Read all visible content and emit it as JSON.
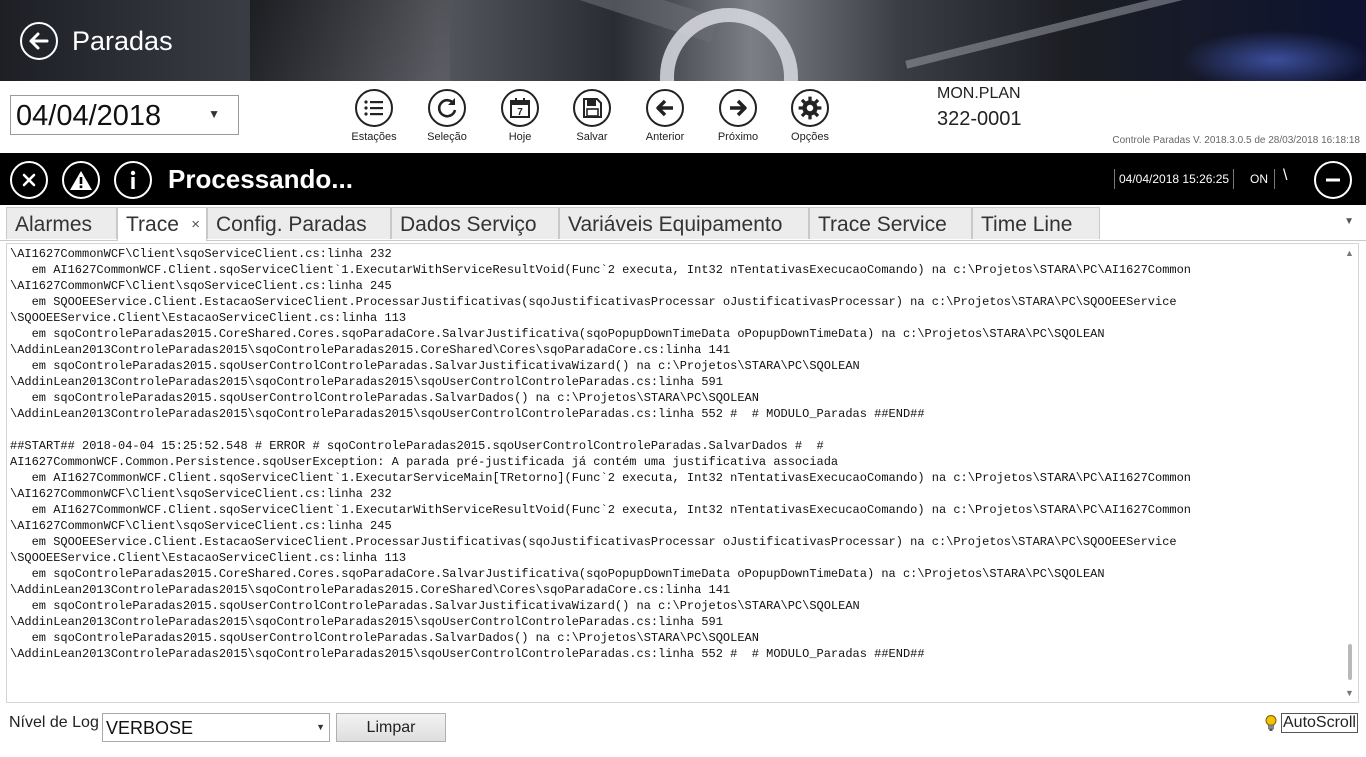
{
  "header": {
    "title": "Paradas",
    "back_icon": "arrow-left-icon"
  },
  "toolbar": {
    "date_value": "04/04/2018",
    "buttons": [
      {
        "label": "Estações",
        "icon": "list-icon"
      },
      {
        "label": "Seleção",
        "icon": "refresh-icon"
      },
      {
        "label": "Hoje",
        "icon": "calendar-icon"
      },
      {
        "label": "Salvar",
        "icon": "save-icon"
      },
      {
        "label": "Anterior",
        "icon": "arrow-left-circle-icon"
      },
      {
        "label": "Próximo",
        "icon": "arrow-right-circle-icon"
      },
      {
        "label": "Opções",
        "icon": "gear-icon"
      }
    ],
    "mon_label": "MON.PLAN",
    "mon_code": "322-0001",
    "version": "Controle Paradas V. 2018.3.0.5 de 28/03/2018 16:18:18"
  },
  "status_bar": {
    "text": "Processando...",
    "datetime": "04/04/2018 15:26:25",
    "connection": "ON",
    "spinner": "\\"
  },
  "tabs": [
    {
      "label": "Alarmes"
    },
    {
      "label": "Trace",
      "active": true,
      "close": "×"
    },
    {
      "label": "Config. Paradas"
    },
    {
      "label": "Dados Serviço"
    },
    {
      "label": "Variáveis Equipamento"
    },
    {
      "label": "Trace Service"
    },
    {
      "label": "Time Line"
    }
  ],
  "log": {
    "lines": [
      "\\AI1627CommonWCF\\Client\\sqoServiceClient.cs:linha 232",
      "   em AI1627CommonWCF.Client.sqoServiceClient`1.ExecutarWithServiceResultVoid(Func`2 executa, Int32 nTentativasExecucaoComando) na c:\\Projetos\\STARA\\PC\\AI1627Common",
      "\\AI1627CommonWCF\\Client\\sqoServiceClient.cs:linha 245",
      "   em SQOOEEService.Client.EstacaoServiceClient.ProcessarJustificativas(sqoJustificativasProcessar oJustificativasProcessar) na c:\\Projetos\\STARA\\PC\\SQOOEEService",
      "\\SQOOEEService.Client\\EstacaoServiceClient.cs:linha 113",
      "   em sqoControleParadas2015.CoreShared.Cores.sqoParadaCore.SalvarJustificativa(sqoPopupDownTimeData oPopupDownTimeData) na c:\\Projetos\\STARA\\PC\\SQOLEAN",
      "\\AddinLean2013ControleParadas2015\\sqoControleParadas2015.CoreShared\\Cores\\sqoParadaCore.cs:linha 141",
      "   em sqoControleParadas2015.sqoUserControlControleParadas.SalvarJustificativaWizard() na c:\\Projetos\\STARA\\PC\\SQOLEAN",
      "\\AddinLean2013ControleParadas2015\\sqoControleParadas2015\\sqoUserControlControleParadas.cs:linha 591",
      "   em sqoControleParadas2015.sqoUserControlControleParadas.SalvarDados() na c:\\Projetos\\STARA\\PC\\SQOLEAN",
      "\\AddinLean2013ControleParadas2015\\sqoControleParadas2015\\sqoUserControlControleParadas.cs:linha 552 #  # MODULO_Paradas ##END##",
      "",
      "##START## 2018-04-04 15:25:52.548 # ERROR # sqoControleParadas2015.sqoUserControlControleParadas.SalvarDados #  #",
      "AI1627CommonWCF.Common.Persistence.sqoUserException: A parada pré-justificada já contém uma justificativa associada",
      "   em AI1627CommonWCF.Client.sqoServiceClient`1.ExecutarServiceMain[TRetorno](Func`2 executa, Int32 nTentativasExecucaoComando) na c:\\Projetos\\STARA\\PC\\AI1627Common",
      "\\AI1627CommonWCF\\Client\\sqoServiceClient.cs:linha 232",
      "   em AI1627CommonWCF.Client.sqoServiceClient`1.ExecutarWithServiceResultVoid(Func`2 executa, Int32 nTentativasExecucaoComando) na c:\\Projetos\\STARA\\PC\\AI1627Common",
      "\\AI1627CommonWCF\\Client\\sqoServiceClient.cs:linha 245",
      "   em SQOOEEService.Client.EstacaoServiceClient.ProcessarJustificativas(sqoJustificativasProcessar oJustificativasProcessar) na c:\\Projetos\\STARA\\PC\\SQOOEEService",
      "\\SQOOEEService.Client\\EstacaoServiceClient.cs:linha 113",
      "   em sqoControleParadas2015.CoreShared.Cores.sqoParadaCore.SalvarJustificativa(sqoPopupDownTimeData oPopupDownTimeData) na c:\\Projetos\\STARA\\PC\\SQOLEAN",
      "\\AddinLean2013ControleParadas2015\\sqoControleParadas2015.CoreShared\\Cores\\sqoParadaCore.cs:linha 141",
      "   em sqoControleParadas2015.sqoUserControlControleParadas.SalvarJustificativaWizard() na c:\\Projetos\\STARA\\PC\\SQOLEAN",
      "\\AddinLean2013ControleParadas2015\\sqoControleParadas2015\\sqoUserControlControleParadas.cs:linha 591",
      "   em sqoControleParadas2015.sqoUserControlControleParadas.SalvarDados() na c:\\Projetos\\STARA\\PC\\SQOLEAN",
      "\\AddinLean2013ControleParadas2015\\sqoControleParadas2015\\sqoUserControlControleParadas.cs:linha 552 #  # MODULO_Paradas ##END##"
    ]
  },
  "footer": {
    "log_level_label": "Nível de Log",
    "log_level_value": "VERBOSE",
    "clear_label": "Limpar",
    "autoscroll_label": "AutoScroll",
    "autoscroll_icon": "lightbulb-icon"
  }
}
